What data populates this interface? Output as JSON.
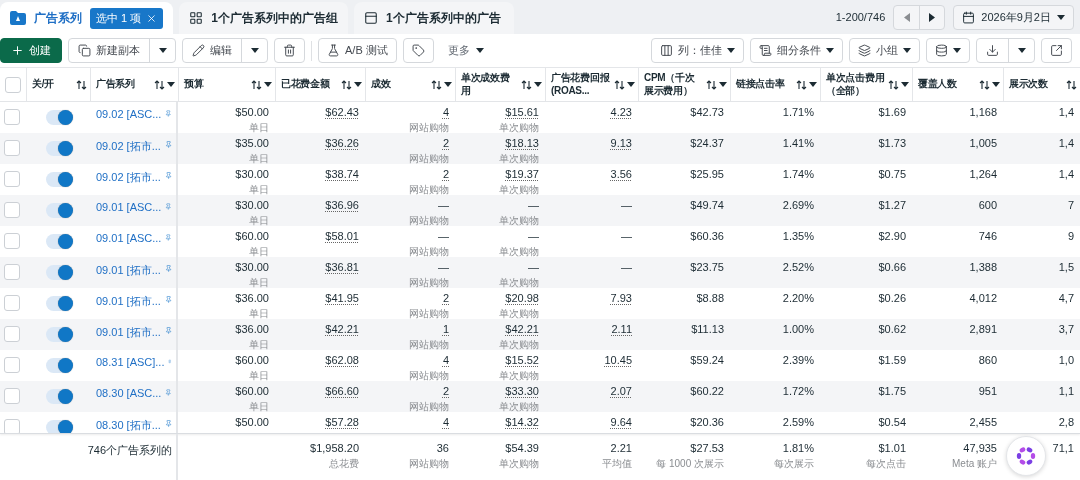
{
  "tabs": [
    {
      "label": "广告系列",
      "selected": true,
      "kind": "campaign",
      "chip": "选中 1 项"
    },
    {
      "label": "1个广告系列中的广告组",
      "selected": false,
      "kind": "adset"
    },
    {
      "label": "1个广告系列中的广告",
      "selected": false,
      "kind": "ad"
    }
  ],
  "pagination": {
    "range": "1-200/746",
    "date": "2026年9月2日"
  },
  "toolbar": {
    "create": "创建",
    "duplicate": "新建副本",
    "edit": "编辑",
    "ab_test": "A/B 测试",
    "more": "更多"
  },
  "view_controls": {
    "columns": "列：佳佳",
    "breakdown": "细分条件",
    "group": "小组"
  },
  "select_all": {
    "checked": false
  },
  "columns": [
    {
      "label": "关/开",
      "menu": false
    },
    {
      "label": "广告系列",
      "menu": true
    },
    {
      "label": "预算",
      "menu": true
    },
    {
      "label": "已花费金额",
      "menu": true
    },
    {
      "label": "成效",
      "menu": true
    },
    {
      "label": "单次成效费用",
      "menu": true
    },
    {
      "label": "广告花费回报 (ROAS...",
      "menu": true
    },
    {
      "label": "CPM（千次展示费用）",
      "menu": true
    },
    {
      "label": "链接点击率",
      "menu": true
    },
    {
      "label": "单次点击费用（全部）",
      "menu": true
    },
    {
      "label": "覆盖人数",
      "menu": true
    },
    {
      "label": "展示次数",
      "menu": false
    }
  ],
  "rows": [
    {
      "selected": false,
      "on": true,
      "name": "09.02 [ASC...",
      "budget": "$50.00",
      "budget_note": "单日",
      "spent": "$62.43",
      "results": "4",
      "results_note": "网站购物",
      "cost": "$15.61",
      "cost_note": "单次购物",
      "roas": "4.23",
      "cpm": "$42.73",
      "ctr": "1.71%",
      "cpc": "$1.69",
      "reach": "1,168",
      "impressions": "1,4"
    },
    {
      "selected": false,
      "on": true,
      "name": "09.02 [拓市...",
      "budget": "$35.00",
      "budget_note": "单日",
      "spent": "$36.26",
      "results": "2",
      "results_note": "网站购物",
      "cost": "$18.13",
      "cost_note": "单次购物",
      "roas": "9.13",
      "cpm": "$24.37",
      "ctr": "1.41%",
      "cpc": "$1.73",
      "reach": "1,005",
      "impressions": "1,4"
    },
    {
      "selected": false,
      "on": true,
      "name": "09.02 [拓市...",
      "budget": "$30.00",
      "budget_note": "单日",
      "spent": "$38.74",
      "results": "2",
      "results_note": "网站购物",
      "cost": "$19.37",
      "cost_note": "单次购物",
      "roas": "3.56",
      "cpm": "$25.95",
      "ctr": "1.74%",
      "cpc": "$0.75",
      "reach": "1,264",
      "impressions": "1,4"
    },
    {
      "selected": false,
      "on": true,
      "name": "09.01 [ASC...",
      "budget": "$30.00",
      "budget_note": "单日",
      "spent": "$36.96",
      "results": "—",
      "results_note": "网站购物",
      "cost": "—",
      "cost_note": "单次购物",
      "roas": "—",
      "cpm": "$49.74",
      "ctr": "2.69%",
      "cpc": "$1.27",
      "reach": "600",
      "impressions": "7"
    },
    {
      "selected": false,
      "on": true,
      "name": "09.01 [ASC...",
      "budget": "$60.00",
      "budget_note": "单日",
      "spent": "$58.01",
      "results": "—",
      "results_note": "网站购物",
      "cost": "—",
      "cost_note": "单次购物",
      "roas": "—",
      "cpm": "$60.36",
      "ctr": "1.35%",
      "cpc": "$2.90",
      "reach": "746",
      "impressions": "9"
    },
    {
      "selected": false,
      "on": true,
      "name": "09.01 [拓市...",
      "budget": "$30.00",
      "budget_note": "单日",
      "spent": "$36.81",
      "results": "—",
      "results_note": "网站购物",
      "cost": "—",
      "cost_note": "单次购物",
      "roas": "—",
      "cpm": "$23.75",
      "ctr": "2.52%",
      "cpc": "$0.66",
      "reach": "1,388",
      "impressions": "1,5"
    },
    {
      "selected": false,
      "on": true,
      "name": "09.01 [拓市...",
      "budget": "$36.00",
      "budget_note": "单日",
      "spent": "$41.95",
      "results": "2",
      "results_note": "网站购物",
      "cost": "$20.98",
      "cost_note": "单次购物",
      "roas": "7.93",
      "cpm": "$8.88",
      "ctr": "2.20%",
      "cpc": "$0.26",
      "reach": "4,012",
      "impressions": "4,7"
    },
    {
      "selected": false,
      "on": true,
      "name": "09.01 [拓市...",
      "budget": "$36.00",
      "budget_note": "单日",
      "spent": "$42.21",
      "results": "1",
      "results_note": "网站购物",
      "cost": "$42.21",
      "cost_note": "单次购物",
      "roas": "2.11",
      "cpm": "$11.13",
      "ctr": "1.00%",
      "cpc": "$0.62",
      "reach": "2,891",
      "impressions": "3,7"
    },
    {
      "selected": false,
      "on": true,
      "name": "08.31 [ASC]...",
      "budget": "$60.00",
      "budget_note": "单日",
      "spent": "$62.08",
      "results": "4",
      "results_note": "网站购物",
      "cost": "$15.52",
      "cost_note": "单次购物",
      "roas": "10.45",
      "cpm": "$59.24",
      "ctr": "2.39%",
      "cpc": "$1.59",
      "reach": "860",
      "impressions": "1,0"
    },
    {
      "selected": false,
      "on": true,
      "name": "08.30 [ASC...",
      "budget": "$60.00",
      "budget_note": "单日",
      "spent": "$66.60",
      "results": "2",
      "results_note": "网站购物",
      "cost": "$33.30",
      "cost_note": "单次购物",
      "roas": "2.07",
      "cpm": "$60.22",
      "ctr": "1.72%",
      "cpc": "$1.75",
      "reach": "951",
      "impressions": "1,1"
    },
    {
      "selected": false,
      "on": true,
      "name": "08.30 [拓市...",
      "budget": "$50.00",
      "spent": "$57.28",
      "results": "4",
      "cost": "$14.32",
      "roas": "9.64",
      "cpm": "$20.36",
      "ctr": "2.59%",
      "cpc": "$0.54",
      "reach": "2,455",
      "impressions": "2,8"
    }
  ],
  "footer": {
    "label": "746个广告系列的",
    "totals": [
      {
        "value": "$1,958.20",
        "note": "总花费"
      },
      {
        "value": "36",
        "note": "网站购物"
      },
      {
        "value": "$54.39",
        "note": "单次购物"
      },
      {
        "value": "2.21",
        "note": "平均值"
      },
      {
        "value": "$27.53",
        "note": "每 1000 次展示"
      },
      {
        "value": "1.81%",
        "note": "每次展示"
      },
      {
        "value": "$1.01",
        "note": "每次点击"
      },
      {
        "value": "47,935",
        "note": "Meta 账户"
      },
      {
        "value": "71,1"
      }
    ]
  }
}
